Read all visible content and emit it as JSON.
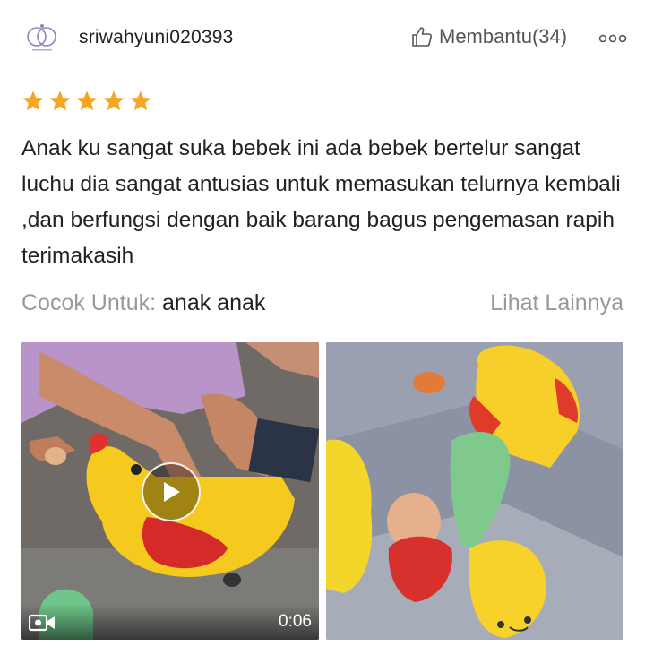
{
  "header": {
    "username": "sriwahyuni020393",
    "helpful_label": "Membantu(34)",
    "avatar_icon": "avatar-rings-icon",
    "thumb_icon": "thumb-up-icon",
    "more_icon": "more-options-icon"
  },
  "rating": {
    "stars": 5,
    "max": 5,
    "star_color": "#F5A623"
  },
  "review": {
    "text": "Anak ku sangat suka bebek ini ada bebek bertelur sangat luchu dia sangat antusias untuk memasukan telurnya kembali ,dan berfungsi dengan baik barang bagus pengemasan rapih terimakasih"
  },
  "suitable": {
    "label": "Cocok Untuk:",
    "value": "anak anak",
    "see_more": "Lihat Lainnya"
  },
  "media": {
    "video": {
      "duration": "0:06",
      "play_icon": "play-icon",
      "camera_icon": "video-camera-icon"
    },
    "photo": {}
  }
}
